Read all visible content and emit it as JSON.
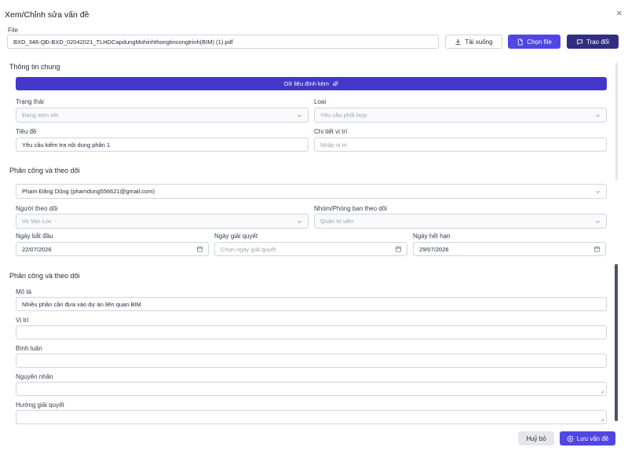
{
  "dialog": {
    "title": "Xem/Chỉnh sửa vấn đề",
    "close_symbol": "×"
  },
  "file": {
    "label": "File",
    "filename": "BXD_348-QĐ-BXD_02042021_TLHDCapdungMohinhthongtincongtrinh(BIM) (1).pdf",
    "download_label": "Tải xuống",
    "choose_label": "Chọn file",
    "discuss_label": "Trao đổi"
  },
  "general": {
    "heading": "Thông tin chung",
    "attach_label": "Dữ liệu đính kèm",
    "status_label": "Trạng thái",
    "status_value": "Đang xem xét",
    "type_label": "Loại",
    "type_value": "Yêu cầu phối hợp",
    "subject_label": "Tiêu đề",
    "subject_value": "Yêu cầu kiểm tra nội dung phần 1",
    "location_detail_label": "Chi tiết vị trí",
    "location_detail_placeholder": "Nhập vị trí"
  },
  "assignment": {
    "heading": "Phân công và theo dõi",
    "assignee_value": "Phạm Đăng Dũng (phamdung556621@gmail.com)",
    "watcher_label": "Người theo dõi",
    "watcher_value": "Vo Van Loc",
    "group_label": "Nhóm/Phòng ban theo dõi",
    "group_value": "Quản trị viên",
    "start_label": "Ngày bắt đầu",
    "start_value": "22/07/2026",
    "resolve_label": "Ngày giải quyết",
    "resolve_placeholder": "Chọn ngày giải quyết",
    "due_label": "Ngày hết hạn",
    "due_value": "29/07/2026"
  },
  "details": {
    "heading": "Phân công và theo dõi",
    "desc_label": "Mô tả",
    "desc_value": "Nhiều phần cần đưa vào dự án liên quan BIM",
    "position_label": "Vị trí",
    "comment_label": "Bình luận",
    "cause_label": "Nguyên nhân",
    "solution_label": "Hướng giải quyết"
  },
  "footer": {
    "cancel_label": "Huỷ bỏ",
    "save_label": "Lưu vấn đề"
  },
  "colors": {
    "primary": "#4f46e5",
    "navy": "#312e81",
    "bar": "#4338ca"
  }
}
